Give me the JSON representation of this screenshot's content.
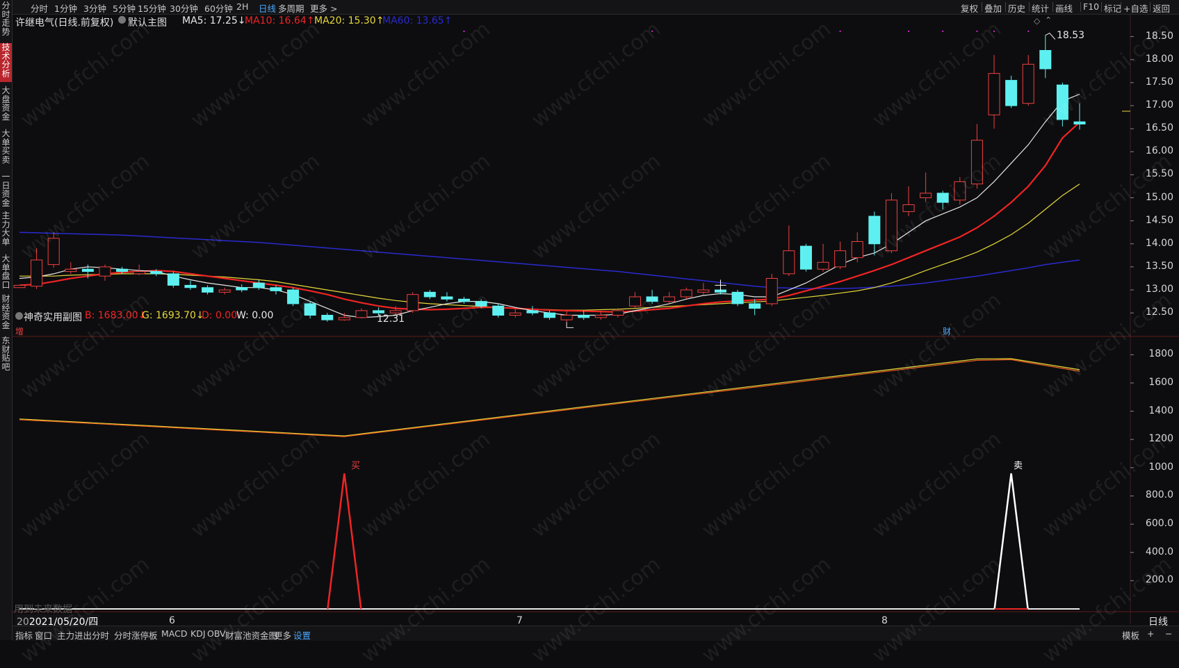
{
  "left_tabs": [
    "分时走势",
    "技术分析",
    "大盘资金",
    "大单买卖",
    "一日资金",
    "主力大单",
    "大单盘口",
    "财经资金",
    "东财贴吧"
  ],
  "left_active": 1,
  "periods": [
    "分时",
    "1分钟",
    "3分钟",
    "5分钟",
    "15分钟",
    "30分钟",
    "60分钟",
    "2H",
    "日线",
    "多周期",
    "更多 >"
  ],
  "period_active": 8,
  "right_tools": [
    "复权",
    "叠加",
    "历史",
    "统计",
    "画线",
    "F10",
    "标记",
    "+自选",
    "返回"
  ],
  "main_header": {
    "stock": "许继电气(日线.前复权)",
    "main_chart": "默认主图",
    "ma5": "MA5: 17.25↓",
    "ma10": "MA10: 16.64↑",
    "ma20": "MA20: 15.30↑",
    "ma60": "MA60: 13.65↑"
  },
  "sub_header": {
    "name": "神奇实用副图",
    "b": "B: 1683.00↓",
    "g": "G: 1693.70↓",
    "d": "D: 0.00",
    "w": "W: 0.00"
  },
  "price_axis": [
    "18.50",
    "18.00",
    "17.50",
    "17.00",
    "16.50",
    "16.00",
    "15.50",
    "15.00",
    "14.50",
    "14.00",
    "13.50",
    "13.00",
    "12.50"
  ],
  "sub_axis": [
    "1800",
    "1600",
    "1400",
    "1200",
    "1000",
    "800.0",
    "600.0",
    "400.0",
    "200.0"
  ],
  "annotations": {
    "high": "18.53",
    "low": "12.31",
    "buy": "买",
    "sell": "卖",
    "zeng": "增",
    "cai": "财",
    "future_data": "用到未来数据"
  },
  "x_axis": {
    "date": "2021/05/20/四",
    "months": [
      "6",
      "7",
      "8"
    ],
    "period_label": "日线"
  },
  "bottom_tabs": [
    "指标",
    "窗口",
    "主力进出分时",
    "分时涨停板",
    "MACD",
    "KDJ",
    "OBV",
    "财富池资金图",
    "更多",
    "设置"
  ],
  "bottom_active": 9,
  "bottom_right": "模板",
  "watermark": "www.cfchi.com",
  "colors": {
    "up": "#f04040",
    "down": "#5ef0f0",
    "ma5": "#e8e8e8",
    "ma10": "#f02424",
    "ma20": "#e6d83a",
    "ma60": "#2a2ad0",
    "accent": "#4aa8ff"
  },
  "chart_data": {
    "type": "candlestick",
    "price_range": [
      12.05,
      18.6
    ],
    "sub_range": [
      0,
      1900
    ],
    "candles": [
      [
        13.05,
        13.1,
        13.0,
        13.0
      ],
      [
        13.08,
        13.65,
        13.9,
        13.02
      ],
      [
        13.55,
        14.12,
        14.25,
        13.48
      ],
      [
        13.4,
        13.45,
        13.6,
        13.35
      ],
      [
        13.45,
        13.4,
        13.55,
        13.25
      ],
      [
        13.3,
        13.5,
        13.55,
        13.2
      ],
      [
        13.45,
        13.4,
        13.5,
        13.35
      ],
      [
        13.35,
        13.4,
        13.55,
        13.32
      ],
      [
        13.4,
        13.35,
        13.45,
        13.3
      ],
      [
        13.35,
        13.1,
        13.4,
        13.05
      ],
      [
        13.1,
        13.05,
        13.2,
        13.0
      ],
      [
        13.05,
        12.95,
        13.1,
        12.9
      ],
      [
        12.95,
        13.0,
        13.05,
        12.9
      ],
      [
        13.05,
        13.0,
        13.12,
        12.95
      ],
      [
        13.15,
        13.05,
        13.22,
        13.0
      ],
      [
        13.05,
        12.98,
        13.1,
        12.9
      ],
      [
        13.0,
        12.7,
        13.05,
        12.65
      ],
      [
        12.7,
        12.45,
        12.75,
        12.38
      ],
      [
        12.45,
        12.35,
        12.5,
        12.31
      ],
      [
        12.35,
        12.4,
        12.5,
        12.33
      ],
      [
        12.4,
        12.55,
        12.6,
        12.38
      ],
      [
        12.55,
        12.5,
        12.62,
        12.45
      ],
      [
        12.5,
        12.55,
        12.65,
        12.45
      ],
      [
        12.55,
        12.9,
        12.95,
        12.5
      ],
      [
        12.95,
        12.85,
        13.0,
        12.8
      ],
      [
        12.85,
        12.8,
        12.95,
        12.75
      ],
      [
        12.8,
        12.75,
        12.85,
        12.7
      ],
      [
        12.75,
        12.65,
        12.8,
        12.6
      ],
      [
        12.65,
        12.45,
        12.7,
        12.4
      ],
      [
        12.45,
        12.5,
        12.6,
        12.4
      ],
      [
        12.55,
        12.5,
        12.65,
        12.45
      ],
      [
        12.5,
        12.4,
        12.55,
        12.35
      ],
      [
        12.35,
        12.45,
        12.55,
        12.3
      ],
      [
        12.45,
        12.4,
        12.55,
        12.35
      ],
      [
        12.4,
        12.45,
        12.55,
        12.35
      ],
      [
        12.45,
        12.55,
        12.6,
        12.4
      ],
      [
        12.65,
        12.85,
        12.95,
        12.6
      ],
      [
        12.85,
        12.75,
        13.0,
        12.7
      ],
      [
        12.75,
        12.85,
        12.95,
        12.7
      ],
      [
        12.85,
        13.0,
        13.05,
        12.8
      ],
      [
        12.95,
        13.0,
        13.15,
        12.9
      ],
      [
        13.0,
        12.95,
        13.05,
        12.9
      ],
      [
        12.95,
        12.7,
        13.0,
        12.65
      ],
      [
        12.7,
        12.6,
        12.8,
        12.45
      ],
      [
        12.7,
        13.25,
        13.35,
        12.65
      ],
      [
        13.35,
        13.85,
        14.4,
        13.3
      ],
      [
        13.95,
        13.45,
        14.0,
        13.4
      ],
      [
        13.45,
        13.6,
        14.0,
        13.4
      ],
      [
        13.5,
        13.85,
        14.05,
        13.45
      ],
      [
        13.7,
        14.05,
        14.25,
        13.6
      ],
      [
        14.6,
        14.0,
        14.7,
        13.75
      ],
      [
        13.85,
        14.95,
        15.1,
        13.8
      ],
      [
        14.7,
        14.85,
        15.25,
        14.6
      ],
      [
        15.0,
        15.1,
        15.55,
        14.9
      ],
      [
        15.1,
        14.9,
        15.15,
        14.75
      ],
      [
        14.95,
        15.35,
        15.45,
        14.85
      ],
      [
        15.3,
        16.25,
        16.6,
        15.2
      ],
      [
        16.8,
        17.7,
        18.1,
        16.5
      ],
      [
        17.55,
        17.0,
        17.65,
        16.95
      ],
      [
        17.05,
        17.9,
        18.1,
        17.0
      ],
      [
        18.2,
        17.8,
        18.53,
        17.6
      ],
      [
        17.45,
        16.7,
        17.5,
        16.55
      ],
      [
        16.65,
        16.6,
        17.05,
        16.48
      ]
    ],
    "ma5": [
      13.25,
      13.28,
      13.35,
      13.45,
      13.5,
      13.48,
      13.45,
      13.42,
      13.4,
      13.3,
      13.22,
      13.15,
      13.1,
      13.05,
      13.05,
      13.0,
      12.9,
      12.75,
      12.6,
      12.45,
      12.4,
      12.42,
      12.45,
      12.55,
      12.62,
      12.7,
      12.75,
      12.75,
      12.7,
      12.62,
      12.55,
      12.5,
      12.45,
      12.45,
      12.45,
      12.47,
      12.55,
      12.62,
      12.7,
      12.8,
      12.88,
      12.92,
      12.9,
      12.85,
      12.85,
      13.0,
      13.15,
      13.35,
      13.55,
      13.7,
      13.8,
      14.0,
      14.25,
      14.5,
      14.65,
      14.8,
      15.0,
      15.35,
      15.75,
      16.15,
      16.65,
      17.1,
      17.25
    ],
    "ma10": [
      13.1,
      13.12,
      13.18,
      13.25,
      13.3,
      13.35,
      13.38,
      13.4,
      13.42,
      13.4,
      13.35,
      13.3,
      13.25,
      13.2,
      13.15,
      13.1,
      13.05,
      12.98,
      12.9,
      12.8,
      12.72,
      12.65,
      12.6,
      12.58,
      12.57,
      12.58,
      12.6,
      12.62,
      12.62,
      12.6,
      12.58,
      12.56,
      12.55,
      12.54,
      12.53,
      12.52,
      12.54,
      12.57,
      12.6,
      12.65,
      12.7,
      12.74,
      12.76,
      12.78,
      12.8,
      12.88,
      12.98,
      13.08,
      13.18,
      13.3,
      13.42,
      13.55,
      13.7,
      13.85,
      14.0,
      14.15,
      14.35,
      14.6,
      14.9,
      15.25,
      15.7,
      16.3,
      16.64
    ],
    "ma20": [
      13.3,
      13.3,
      13.3,
      13.32,
      13.33,
      13.34,
      13.35,
      13.35,
      13.35,
      13.34,
      13.32,
      13.3,
      13.28,
      13.25,
      13.22,
      13.18,
      13.12,
      13.06,
      13.0,
      12.94,
      12.88,
      12.82,
      12.77,
      12.73,
      12.7,
      12.68,
      12.66,
      12.64,
      12.62,
      12.6,
      12.58,
      12.57,
      12.56,
      12.56,
      12.57,
      12.58,
      12.6,
      12.62,
      12.64,
      12.66,
      12.68,
      12.7,
      12.72,
      12.74,
      12.76,
      12.8,
      12.84,
      12.88,
      12.93,
      12.98,
      13.05,
      13.15,
      13.28,
      13.42,
      13.55,
      13.68,
      13.82,
      14.0,
      14.2,
      14.45,
      14.75,
      15.05,
      15.3
    ],
    "ma60": [
      14.25,
      14.24,
      14.23,
      14.22,
      14.21,
      14.2,
      14.19,
      14.17,
      14.15,
      14.13,
      14.11,
      14.09,
      14.07,
      14.05,
      14.03,
      14.0,
      13.97,
      13.94,
      13.91,
      13.88,
      13.85,
      13.82,
      13.79,
      13.76,
      13.73,
      13.7,
      13.67,
      13.64,
      13.61,
      13.58,
      13.55,
      13.52,
      13.49,
      13.46,
      13.43,
      13.4,
      13.36,
      13.32,
      13.28,
      13.24,
      13.2,
      13.16,
      13.12,
      13.08,
      13.05,
      13.04,
      13.03,
      13.03,
      13.03,
      13.04,
      13.06,
      13.08,
      13.11,
      13.15,
      13.2,
      13.25,
      13.3,
      13.36,
      13.42,
      13.48,
      13.55,
      13.6,
      13.65
    ],
    "sub_b": [
      [
        0,
        1340
      ],
      [
        19,
        1220
      ],
      [
        56,
        1760
      ],
      [
        58,
        1765
      ],
      [
        62,
        1683
      ]
    ],
    "sub_g": [
      [
        0,
        1345
      ],
      [
        19,
        1225
      ],
      [
        56,
        1770
      ],
      [
        58,
        1772
      ],
      [
        62,
        1693.7
      ]
    ],
    "buy_signal": {
      "index": 19,
      "value": 960
    },
    "sell_signal": {
      "index": 58,
      "value": 960
    }
  }
}
